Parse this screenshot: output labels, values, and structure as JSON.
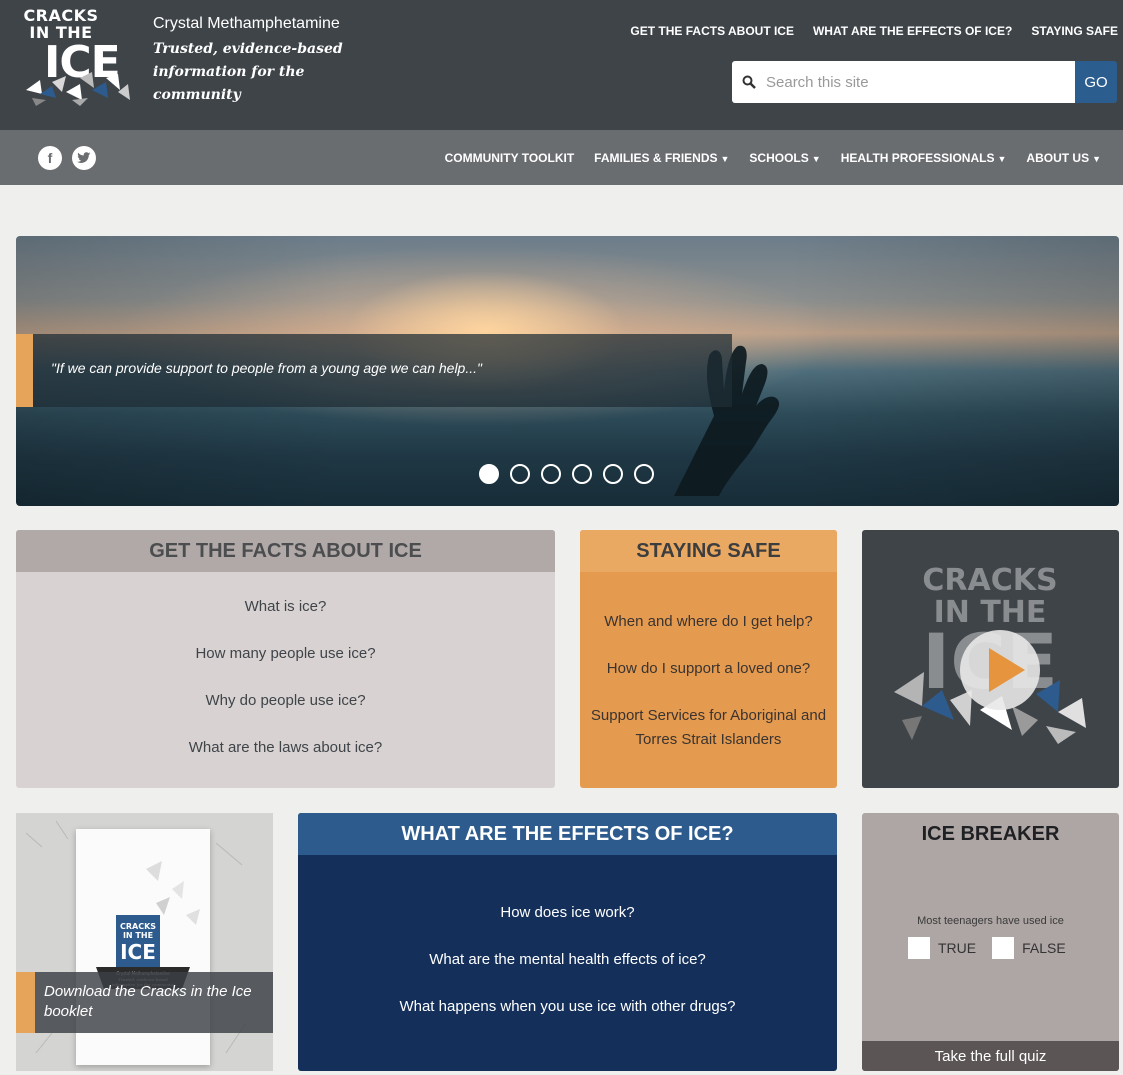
{
  "header": {
    "logo_text": [
      "CRACKS",
      "IN THE",
      "ICE"
    ],
    "site_name": "Crystal Methamphetamine",
    "tagline": "Trusted, evidence-based information for the community",
    "top_nav": [
      "GET THE FACTS ABOUT ICE",
      "WHAT ARE THE EFFECTS OF ICE?",
      "STAYING SAFE"
    ],
    "search": {
      "placeholder": "Search this site",
      "button": "GO"
    }
  },
  "main_nav": {
    "social": [
      "facebook-icon",
      "twitter-icon"
    ],
    "items": [
      {
        "label": "COMMUNITY TOOLKIT",
        "dropdown": false
      },
      {
        "label": "FAMILIES & FRIENDS",
        "dropdown": true
      },
      {
        "label": "SCHOOLS",
        "dropdown": true
      },
      {
        "label": "HEALTH PROFESSIONALS",
        "dropdown": true
      },
      {
        "label": "ABOUT US",
        "dropdown": true
      }
    ],
    "dropdown_glyph": "▼"
  },
  "hero": {
    "quote": "\"If we can provide support to people from a young age we can help...\"",
    "slide_count": 6,
    "active_slide": 1
  },
  "facts": {
    "title": "GET THE FACTS ABOUT ICE",
    "links": [
      "What is ice?",
      "How many people use ice?",
      "Why do people use ice?",
      "What are the laws about ice?"
    ]
  },
  "safe": {
    "title": "STAYING SAFE",
    "links": [
      "When and where do I get help?",
      "How do I support a loved one?",
      "Support Services for Aboriginal and Torres Strait Islanders"
    ]
  },
  "video": {
    "logo_text": [
      "CRACKS",
      "IN THE",
      "ICE"
    ],
    "icon": "play-icon"
  },
  "booklet": {
    "cover_logo": [
      "CRACKS",
      "IN THE",
      "ICE"
    ],
    "cover_small": [
      "Crystal Methamphetamine",
      "Trusted, evidence-based",
      "information for the community"
    ],
    "caption": "Download the Cracks in the Ice booklet"
  },
  "effects": {
    "title": "WHAT ARE THE EFFECTS OF ICE?",
    "links": [
      "How does ice work?",
      "What are the mental health effects of ice?",
      "What happens when you use ice with other drugs?"
    ]
  },
  "quiz": {
    "title": "ICE BREAKER",
    "question": "Most teenagers have used ice",
    "options": [
      "TRUE",
      "FALSE"
    ],
    "cta": "Take the full quiz"
  },
  "colors": {
    "header_bg": "#3f4449",
    "nav_bg": "#6a6d70",
    "accent_orange": "#e6a45a",
    "go_blue": "#2c5d8f",
    "effects_navy": "#14305a"
  }
}
